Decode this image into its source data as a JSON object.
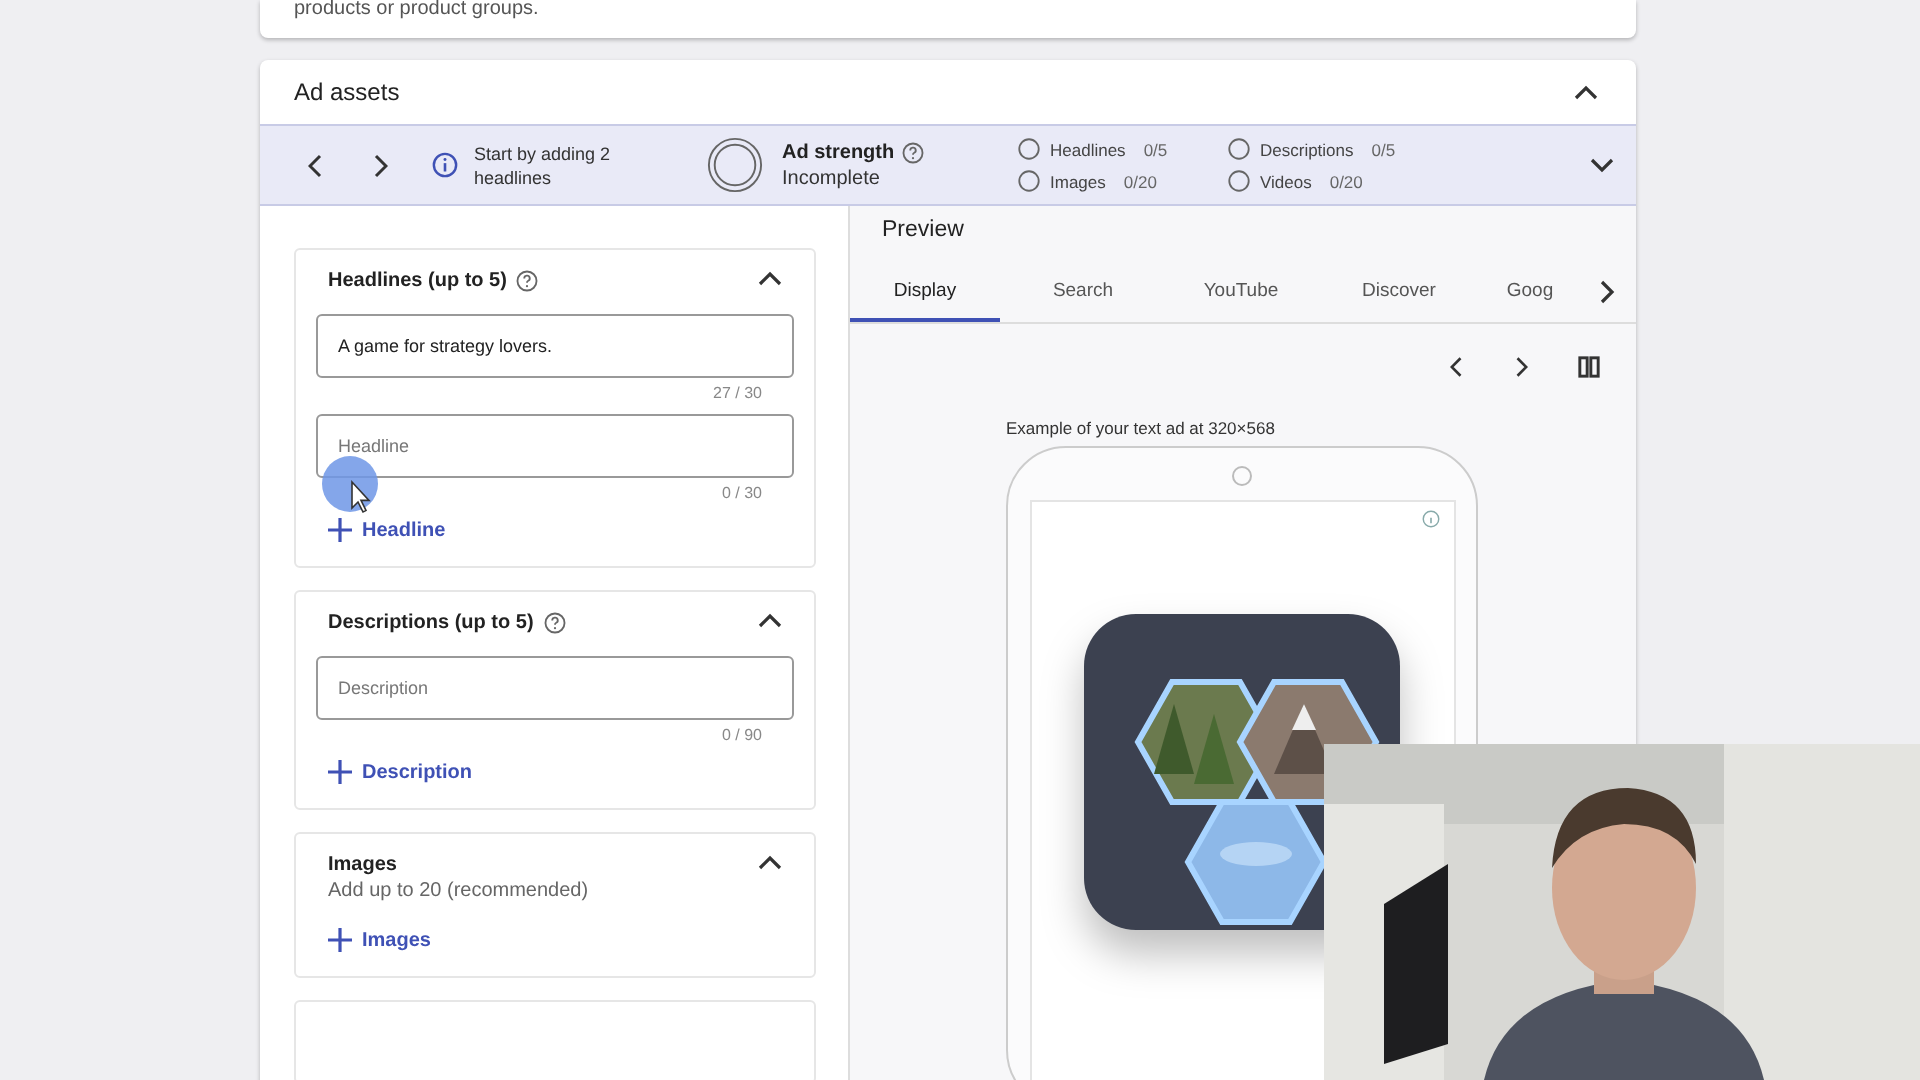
{
  "top_card": {
    "text": "products or product groups."
  },
  "ad_assets": {
    "title": "Ad assets",
    "expanded": true
  },
  "summary_bar": {
    "hint": "Start by adding 2 headlines",
    "strength_label": "Ad strength",
    "strength_value": "Incomplete",
    "counts": [
      {
        "label": "Headlines",
        "count": "0/5",
        "checked": false
      },
      {
        "label": "Images",
        "count": "0/20",
        "checked": false
      },
      {
        "label": "Descriptions",
        "count": "0/5",
        "checked": false
      },
      {
        "label": "Videos",
        "count": "0/20",
        "checked": false
      }
    ]
  },
  "sections": [
    {
      "kind": "fields",
      "title": "Headlines (up to 5)",
      "help": true,
      "expanded": true,
      "fields": [
        {
          "value": "A game for strategy lovers.",
          "counter": "27 / 30"
        },
        {
          "placeholder": "Headline",
          "counter": "0 / 30"
        }
      ],
      "add": "Headline"
    },
    {
      "kind": "fields",
      "title": "Descriptions (up to 5)",
      "help": true,
      "expanded": true,
      "fields": [
        {
          "placeholder": "Description",
          "counter": "0 / 90"
        }
      ],
      "add": "Description"
    },
    {
      "kind": "images",
      "title": "Images",
      "subtitle": "Add up to 20 (recommended)",
      "help": false,
      "expanded": true,
      "add": "Images"
    }
  ],
  "preview": {
    "title": "Preview",
    "tabs": [
      {
        "label": "Display",
        "selected": true
      },
      {
        "label": "Search",
        "selected": false
      },
      {
        "label": "YouTube",
        "selected": false
      },
      {
        "label": "Discover",
        "selected": false
      },
      {
        "label": "Goog",
        "selected": false
      }
    ],
    "caption": "Example of your text ad at 320×568"
  }
}
